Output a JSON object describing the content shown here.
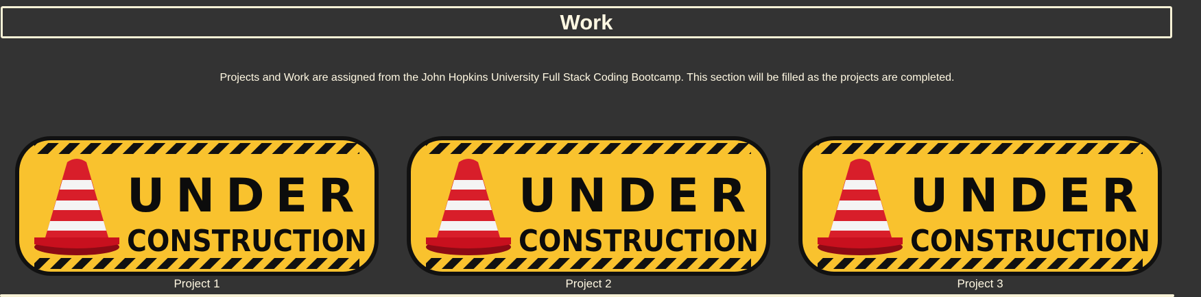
{
  "header": {
    "title": "Work"
  },
  "intro": {
    "text": "Projects and Work are assigned from the John Hopkins University Full Stack Coding Bootcamp. This section will be filled as the projects are completed."
  },
  "projects": [
    {
      "sign_line1": "UNDER",
      "sign_line2": "CONSTRUCTION",
      "caption": "Project 1"
    },
    {
      "sign_line1": "UNDER",
      "sign_line2": "CONSTRUCTION",
      "caption": "Project 2"
    },
    {
      "sign_line1": "UNDER",
      "sign_line2": "CONSTRUCTION",
      "caption": "Project 3"
    }
  ],
  "colors": {
    "background": "#333333",
    "sign_yellow": "#f9c22e",
    "cone_red": "#c8101e",
    "text_light": "#fff8e2"
  },
  "icons": [
    "traffic-cone-icon"
  ]
}
